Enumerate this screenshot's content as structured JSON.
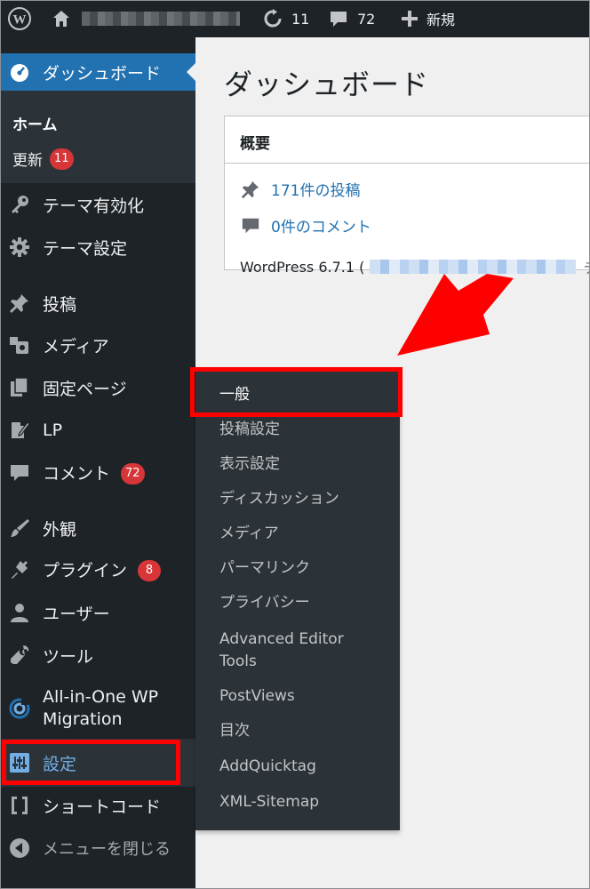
{
  "adminbar": {
    "updates_count": "11",
    "comments_count": "72",
    "new_label": "新規"
  },
  "sidebar": {
    "dashboard_label": "ダッシュボード",
    "home_label": "ホーム",
    "updates_label": "更新",
    "updates_badge": "11",
    "items": [
      {
        "label": "テーマ有効化"
      },
      {
        "label": "テーマ設定"
      },
      {
        "label": "投稿"
      },
      {
        "label": "メディア"
      },
      {
        "label": "固定ページ"
      },
      {
        "label": "LP"
      },
      {
        "label": "コメント",
        "badge": "72"
      },
      {
        "label": "外観"
      },
      {
        "label": "プラグイン",
        "badge": "8"
      },
      {
        "label": "ユーザー"
      },
      {
        "label": "ツール"
      },
      {
        "label_line1": "All-in-One WP",
        "label_line2": "Migration"
      },
      {
        "label": "設定"
      },
      {
        "label": "ショートコード"
      },
      {
        "label": "メニューを閉じる"
      }
    ]
  },
  "flyout": {
    "items": [
      {
        "label": "一般"
      },
      {
        "label": "投稿設定"
      },
      {
        "label": "表示設定"
      },
      {
        "label": "ディスカッション"
      },
      {
        "label": "メディア"
      },
      {
        "label": "パーマリンク"
      },
      {
        "label": "プライバシー"
      },
      {
        "label_line1": "Advanced Editor",
        "label_line2": "Tools"
      },
      {
        "label": "PostViews"
      },
      {
        "label": "目次"
      },
      {
        "label": "AddQuicktag"
      },
      {
        "label": "XML-Sitemap"
      }
    ]
  },
  "main": {
    "page_title": "ダッシュボード",
    "glance": {
      "title": "概要",
      "posts_link": "171件の投稿",
      "comments_link": "0件のコメント",
      "wp_version_prefix": "WordPress 6.7.1 (",
      "wp_version_trailing": "テ"
    }
  },
  "colors": {
    "sidebar_bg": "#1d2327",
    "submenu_bg": "#2c3338",
    "accent": "#2271b1",
    "highlight_red": "#ff0000",
    "badge_red": "#d63638"
  }
}
